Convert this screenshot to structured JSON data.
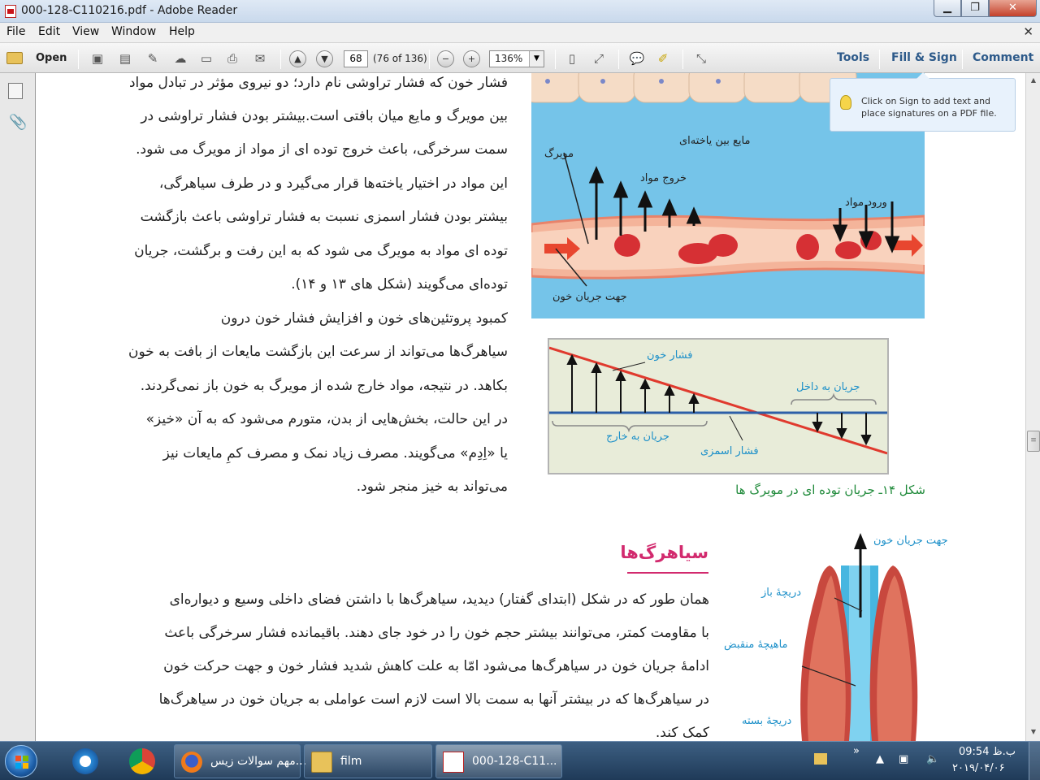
{
  "window": {
    "title": "000-128-C110216.pdf - Adobe Reader",
    "controls": {
      "minimize": "▁",
      "maximize": "❐",
      "close": "✕"
    }
  },
  "menu": {
    "items": [
      "File",
      "Edit",
      "View",
      "Window",
      "Help"
    ],
    "close_doc": "✕"
  },
  "toolbar": {
    "open_label": "Open",
    "page_current": "68",
    "page_count": "(76 of 136)",
    "zoom": "136%",
    "right_links": [
      "Tools",
      "Fill & Sign",
      "Comment"
    ]
  },
  "tooltip": {
    "text": "Click on Sign to add text and place signatures on a PDF file."
  },
  "document": {
    "col1_lines": [
      "فشار خون که فشار تراوشی نام دارد؛ دو نیروی مؤثر در تبادل مواد",
      "بین مویرگ و مایع میان بافتی است.بیشتر بودن فشار تراوشی در",
      "سمت سرخرگی، باعث خروج توده ای از مواد از مویرگ می شود.",
      "این مواد در اختیار یاخته‌ها قرار می‌گیرد و در طرف سیاهرگی،",
      "بیشتر بودن فشار اسمزی نسبت به فشار تراوشی باعث بازگشت",
      "توده ای مواد به مویرگ می شود که به این رفت و برگشت، جریان",
      "توده‌ای می‌گویند (شکل های ۱۳ و ۱۴).",
      "کمبود پروتئین‌های خون و افزایش فشار خون درون",
      "سیاهرگ‌ها می‌تواند از سرعت این بازگشت مایعات از بافت به خون",
      "بکاهد. در نتیجه، مواد خارج شده از مویرگ به خون باز نمی‌گردند.",
      "در این حالت، بخش‌هایی از بدن، متورم می‌شود که به آن «خیز»",
      "یا «اِدِم» می‌گویند. مصرف زیاد نمک و مصرف کمِ مایعات نیز",
      "می‌تواند به خیز منجر شود."
    ],
    "heading": "سیاهرگ‌ها",
    "col2_lines": [
      "همان طور که در شکل (ابتدای گفتار) دیدید، سیاهرگ‌ها با داشتن فضای داخلی وسیع و دیواره‌ای",
      "با مقاومت کمتر، می‌توانند بیشتر حجم خون را در خود جای دهند. باقیمانده فشار سرخرگی باعث",
      "ادامهٔ جریان خون در سیاهرگ‌ها می‌شود امّا به علت کاهش شدید فشار خون و جهت حرکت خون",
      "در سیاهرگ‌ها که در بیشتر آنها به سمت بالا است لازم است عواملی به جریان خون در سیاهرگ‌ها",
      "کمک کند."
    ],
    "fig1_labels": {
      "interstitial": "مایع بین یاخته‌ای",
      "capillary": "مویرگ",
      "exit": "خروج مواد",
      "entry": "ورود مواد",
      "flow": "جهت جریان خون"
    },
    "fig2_labels": {
      "blood_pressure": "فشار خون",
      "inflow": "جریان به داخل",
      "outflow": "جریان به خارج",
      "osmotic": "فشار اسمزی"
    },
    "fig2_caption": "شکل ۱۴ـ جریان توده ای در مویرگ ها",
    "fig3_labels": {
      "flow_dir": "جهت جریان خون",
      "valve_open": "دریچهٔ باز",
      "muscle": "ماهیچهٔ منقبض",
      "valve_closed": "دریچهٔ بسته"
    }
  },
  "taskbar": {
    "tasks": [
      {
        "label": "مهم سوالات زیس..."
      },
      {
        "label": "film"
      },
      {
        "label": "000-128-C11..."
      }
    ],
    "clock_time": "ب.ظ 09:54",
    "clock_date": "۲۰۱۹/۰۴/۰۶",
    "tray_chevron": "»"
  },
  "colors": {
    "heading": "#d22a6e",
    "caption": "#1f8a3a",
    "figure_label": "#1d90c9",
    "link": "#2d5a8a"
  }
}
